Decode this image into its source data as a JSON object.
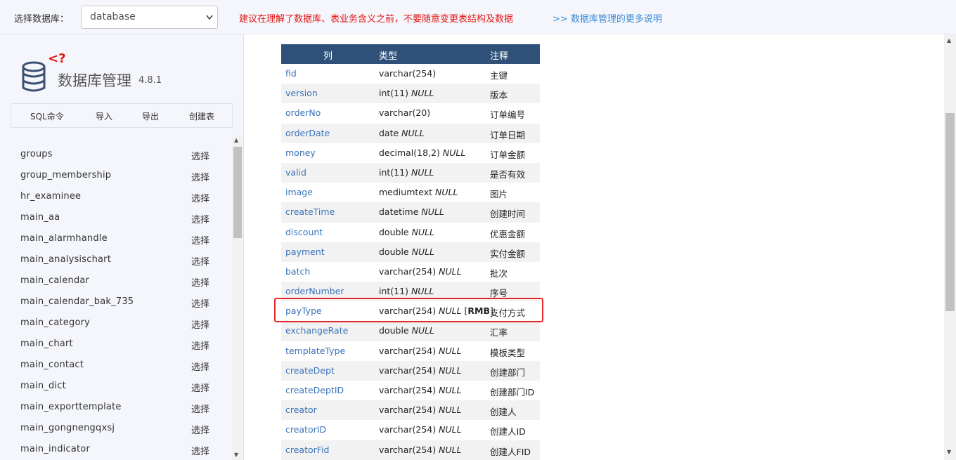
{
  "topbar": {
    "db_label": "选择数据库：",
    "db_value": "database",
    "warning": "建议在理解了数据库、表业务含义之前，不要随意变更表结构及数据",
    "more_link": ">> 数据库管理的更多说明"
  },
  "sidebar": {
    "logo_badge": "<?",
    "title": "数据库管理",
    "version": "4.8.1",
    "toolbar": {
      "sql": "SQL命令",
      "import": "导入",
      "export": "导出",
      "create": "创建表"
    },
    "select_label": "选择",
    "tables": [
      "groups",
      "group_membership",
      "hr_examinee",
      "main_aa",
      "main_alarmhandle",
      "main_analysischart",
      "main_calendar",
      "main_calendar_bak_735",
      "main_category",
      "main_chart",
      "main_contact",
      "main_dict",
      "main_exporttemplate",
      "main_gongnengqxsj",
      "main_indicator"
    ]
  },
  "grid": {
    "headers": {
      "col": "列",
      "type": "类型",
      "comment": "注释"
    },
    "rows": [
      {
        "col": "fid",
        "type": "varchar(254)",
        "null": "",
        "extra": "",
        "comment": "主键"
      },
      {
        "col": "version",
        "type": "int(11)",
        "null": "NULL",
        "extra": "",
        "comment": "版本"
      },
      {
        "col": "orderNo",
        "type": "varchar(20)",
        "null": "",
        "extra": "",
        "comment": "订单编号"
      },
      {
        "col": "orderDate",
        "type": "date",
        "null": "NULL",
        "extra": "",
        "comment": "订单日期"
      },
      {
        "col": "money",
        "type": "decimal(18,2)",
        "null": "NULL",
        "extra": "",
        "comment": "订单金额"
      },
      {
        "col": "valid",
        "type": "int(11)",
        "null": "NULL",
        "extra": "",
        "comment": "是否有效"
      },
      {
        "col": "image",
        "type": "mediumtext",
        "null": "NULL",
        "extra": "",
        "comment": "图片"
      },
      {
        "col": "createTime",
        "type": "datetime",
        "null": "NULL",
        "extra": "",
        "comment": "创建时间"
      },
      {
        "col": "discount",
        "type": "double",
        "null": "NULL",
        "extra": "",
        "comment": "优惠金额"
      },
      {
        "col": "payment",
        "type": "double",
        "null": "NULL",
        "extra": "",
        "comment": "实付金额"
      },
      {
        "col": "batch",
        "type": "varchar(254)",
        "null": "NULL",
        "extra": "",
        "comment": "批次"
      },
      {
        "col": "orderNumber",
        "type": "int(11)",
        "null": "NULL",
        "extra": "",
        "comment": "序号"
      },
      {
        "col": "payType",
        "type": "varchar(254)",
        "null": "NULL",
        "extra": "RMB",
        "comment": "支付方式"
      },
      {
        "col": "exchangeRate",
        "type": "double",
        "null": "NULL",
        "extra": "",
        "comment": "汇率"
      },
      {
        "col": "templateType",
        "type": "varchar(254)",
        "null": "NULL",
        "extra": "",
        "comment": "模板类型"
      },
      {
        "col": "createDept",
        "type": "varchar(254)",
        "null": "NULL",
        "extra": "",
        "comment": "创建部门"
      },
      {
        "col": "createDeptID",
        "type": "varchar(254)",
        "null": "NULL",
        "extra": "",
        "comment": "创建部门ID"
      },
      {
        "col": "creator",
        "type": "varchar(254)",
        "null": "NULL",
        "extra": "",
        "comment": "创建人"
      },
      {
        "col": "creatorID",
        "type": "varchar(254)",
        "null": "NULL",
        "extra": "",
        "comment": "创建人ID"
      },
      {
        "col": "creatorFid",
        "type": "varchar(254)",
        "null": "NULL",
        "extra": "",
        "comment": "创建人FID"
      }
    ],
    "highlighted_row": "payType",
    "highlight_color": "#e5272a",
    "header_color": "#2f5079"
  }
}
